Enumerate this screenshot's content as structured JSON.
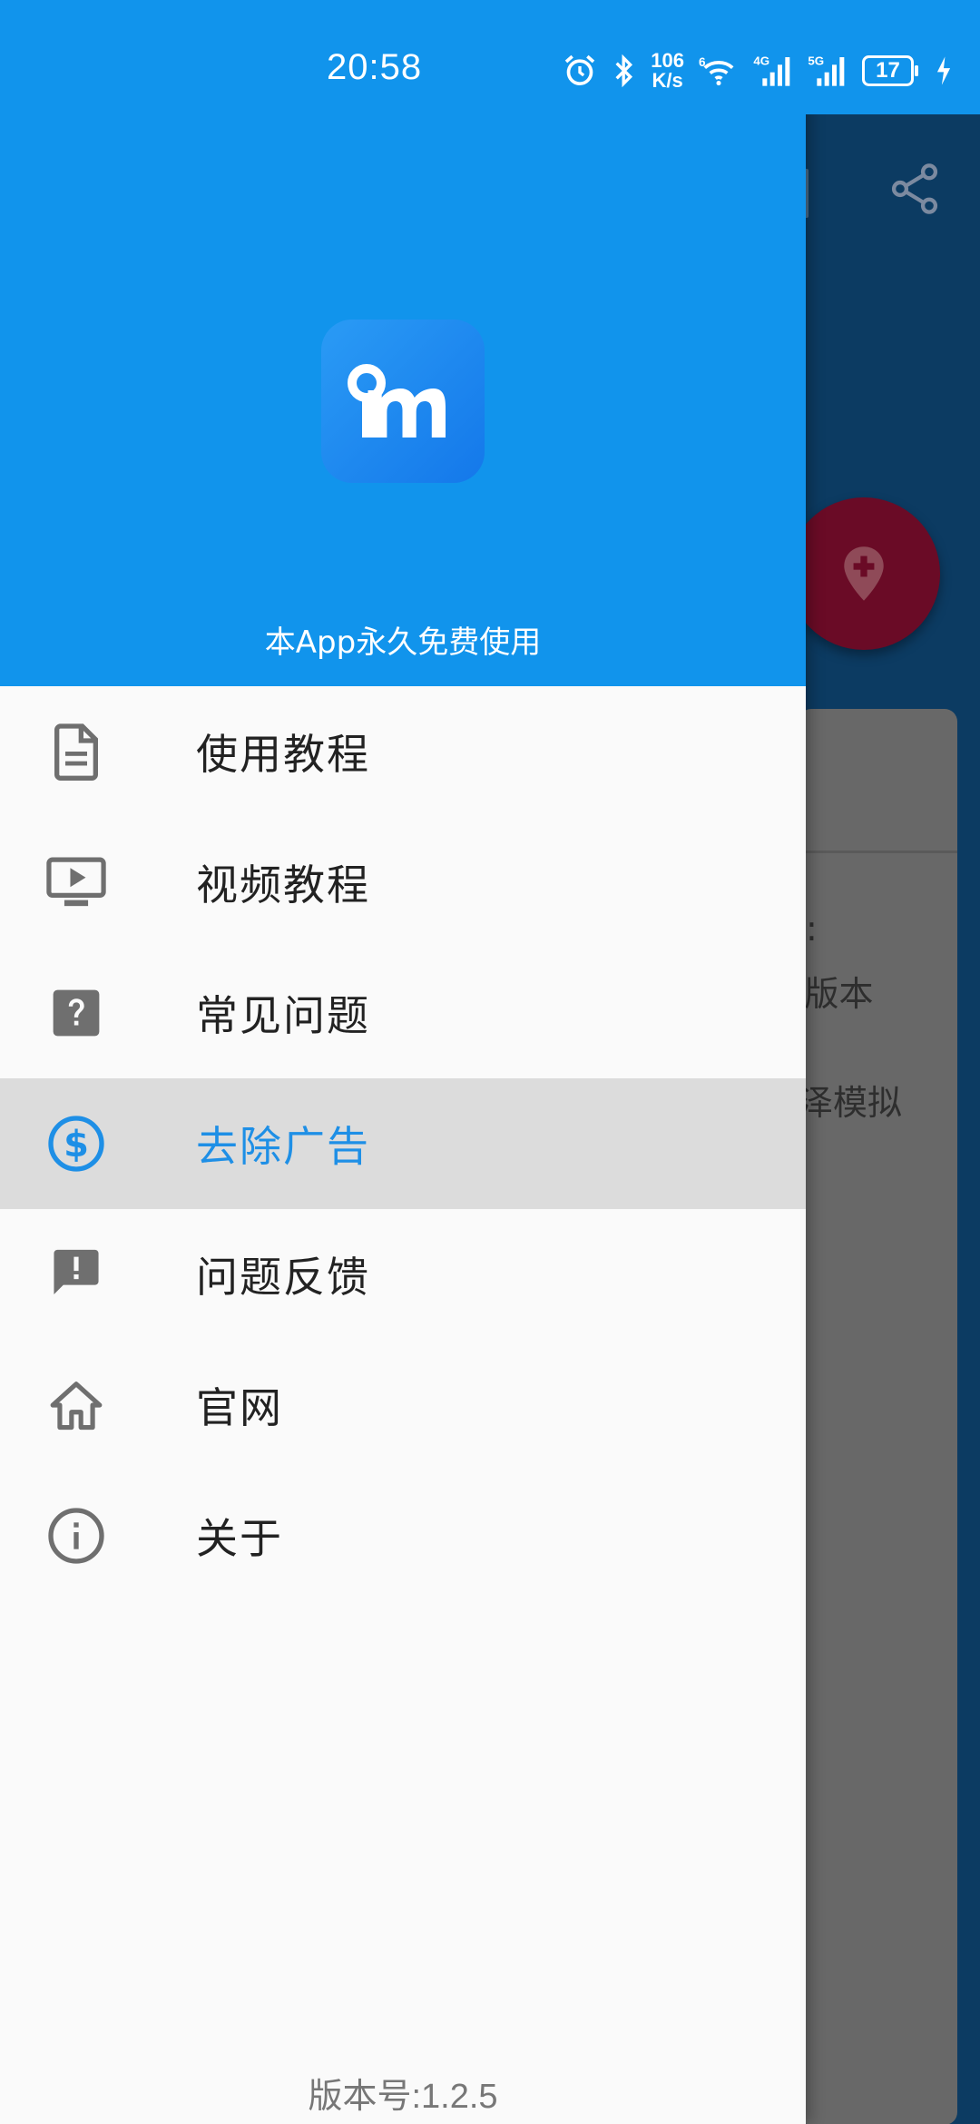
{
  "status_bar": {
    "time": "20:58",
    "net_speed_value": "106",
    "net_speed_unit": "K/s",
    "network_1": "5G",
    "network_2": "4G",
    "network_3": "5G",
    "battery": "17"
  },
  "drawer": {
    "header_caption": "本App永久免费使用",
    "items": [
      {
        "label": "使用教程",
        "icon": "document-icon"
      },
      {
        "label": "视频教程",
        "icon": "video-tv-icon"
      },
      {
        "label": "常见问题",
        "icon": "help-box-icon"
      },
      {
        "label": "去除广告",
        "icon": "dollar-circle-icon",
        "selected": true
      },
      {
        "label": "问题反馈",
        "icon": "feedback-icon"
      },
      {
        "label": "官网",
        "icon": "home-icon"
      },
      {
        "label": "关于",
        "icon": "info-icon"
      }
    ],
    "version": "版本号:1.2.5"
  },
  "background": {
    "text_1": ":",
    "text_2": "'版本",
    "text_3": "泽模拟"
  },
  "colors": {
    "header_blue": "#1194ec",
    "selected_text": "#1e8fe6",
    "fab": "#6a0b26"
  }
}
